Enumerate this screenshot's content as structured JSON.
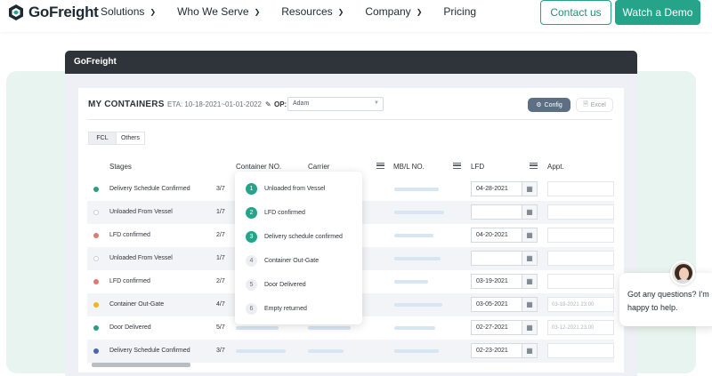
{
  "brand": {
    "name": "GoFreight",
    "accent": "#25a48a"
  },
  "nav": {
    "items": [
      {
        "label": "Solutions",
        "has_dropdown": true
      },
      {
        "label": "Who We Serve",
        "has_dropdown": true
      },
      {
        "label": "Resources",
        "has_dropdown": true
      },
      {
        "label": "Company",
        "has_dropdown": true
      },
      {
        "label": "Pricing",
        "has_dropdown": false
      }
    ],
    "contact_label": "Contact us",
    "demo_label": "Watch a Demo"
  },
  "app": {
    "window_title": "GoFreight",
    "title": "MY CONTAINERS",
    "eta": "ETA: 10-18-2021~01-01-2022",
    "op_label": "OP:",
    "op_value": "Adam",
    "config_label": "Config",
    "excel_label": "Excel",
    "tabs": [
      {
        "label": "FCL",
        "active": true
      },
      {
        "label": "Others",
        "active": false
      }
    ],
    "columns": [
      "Stages",
      "Container NO.",
      "Carrier",
      "MB/L NO.",
      "LFD",
      "Appt."
    ],
    "rows": [
      {
        "stage": "Delivery Schedule Confirmed",
        "count": "3/7",
        "dot": "#2a9d7f",
        "lfd": "04-28-2021",
        "appt": ""
      },
      {
        "stage": "Unloaded From Vessel",
        "count": "1/7",
        "dot": "hollow",
        "lfd": "",
        "appt": ""
      },
      {
        "stage": "LFD confirmed",
        "count": "2/7",
        "dot": "#e07a6f",
        "lfd": "04-20-2021",
        "appt": ""
      },
      {
        "stage": "Unloaded From Vessel",
        "count": "1/7",
        "dot": "hollow",
        "lfd": "",
        "appt": ""
      },
      {
        "stage": "LFD confirmed",
        "count": "2/7",
        "dot": "#e07a6f",
        "lfd": "03-19-2021",
        "appt": ""
      },
      {
        "stage": "Container Out-Gate",
        "count": "4/7",
        "dot": "#f2b51d",
        "lfd": "03-05-2021",
        "appt": "03-18-2021 23:00"
      },
      {
        "stage": "Door Delivered",
        "count": "5/7",
        "dot": "#2a9d7f",
        "lfd": "02-27-2021",
        "appt": "03-12-2021 23:00"
      },
      {
        "stage": "Delivery Schedule Confirmed",
        "count": "3/7",
        "dot": "#4a63b5",
        "lfd": "02-23-2021",
        "appt": ""
      }
    ],
    "stage_popover": [
      {
        "num": "1",
        "label": "Unloaded from Vessel",
        "done": true
      },
      {
        "num": "2",
        "label": "LFD confirmed",
        "done": true
      },
      {
        "num": "3",
        "label": "Delivery schedule confirmed",
        "done": true
      },
      {
        "num": "4",
        "label": "Container Out-Gate",
        "done": false
      },
      {
        "num": "5",
        "label": "Door Delivered",
        "done": false
      },
      {
        "num": "6",
        "label": "Empty returned",
        "done": false
      }
    ]
  },
  "chat": {
    "message": "Got any questions? I'm happy to help."
  }
}
